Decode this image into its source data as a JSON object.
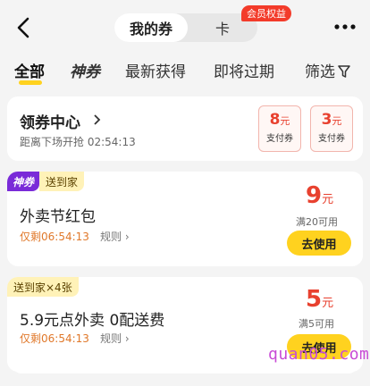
{
  "header": {
    "seg_active": "我的券",
    "seg_inactive": "卡",
    "badge": "会员权益"
  },
  "tabs": {
    "all": "全部",
    "shen": "神券",
    "latest": "最新获得",
    "expiring": "即将过期",
    "filter": "筛选"
  },
  "center": {
    "title": "领券中心",
    "subtitle": "距离下场开抢 02:54:13",
    "coupons": [
      {
        "amount": "8",
        "unit": "元",
        "label": "支付券"
      },
      {
        "amount": "3",
        "unit": "元",
        "label": "支付券"
      }
    ]
  },
  "coupon1": {
    "tag_shen": "神券",
    "tag_delivery": "送到家",
    "title": "外卖节红包",
    "remain": "仅剩06:54:13",
    "rule": "规则",
    "amount": "9",
    "unit": "元",
    "condition": "满20可用",
    "button": "去使用"
  },
  "coupon2": {
    "tag": "送到家×4张",
    "title": "5.9元点外卖 0配送费",
    "remain": "仅剩06:54:13",
    "rule": "规则",
    "amount": "5",
    "unit": "元",
    "condition": "满5可用",
    "button": "去使用"
  },
  "watermark": "quan05.com",
  "colors": {
    "accent_yellow": "#ffd21f",
    "price_red": "#e8412f",
    "badge_red": "#f33b2a",
    "shen_purple": "#7a2bd8"
  }
}
